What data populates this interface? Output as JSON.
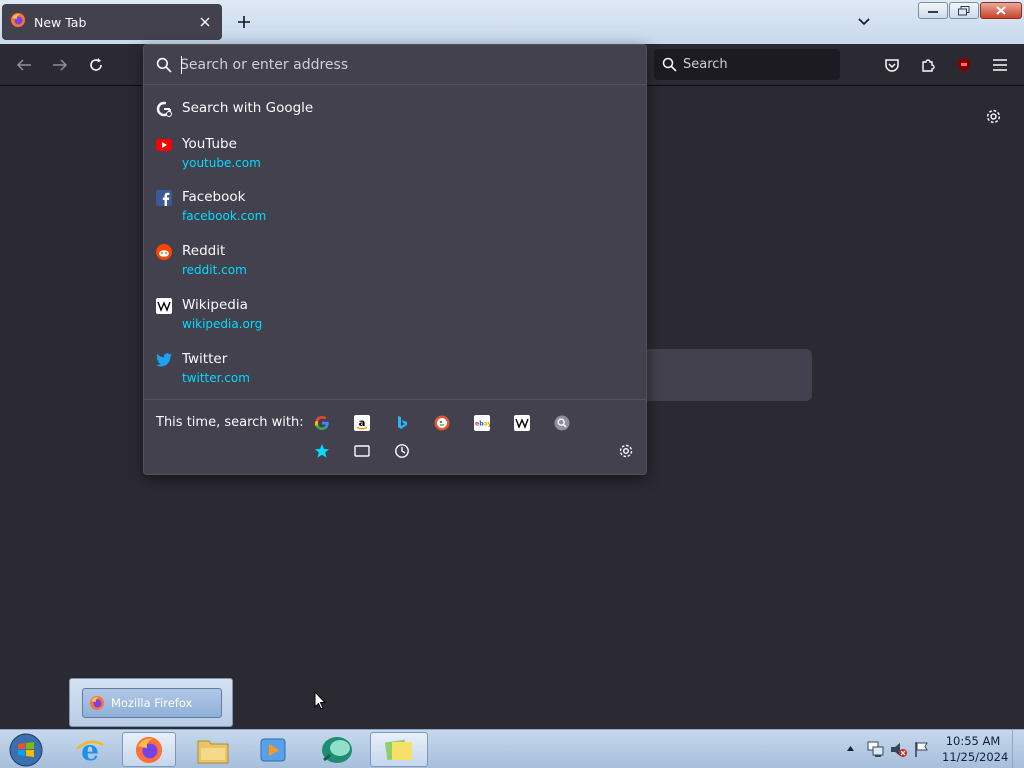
{
  "browser": {
    "tab_title": "New Tab",
    "search_placeholder": "Search",
    "urlbar_placeholder": "Search or enter address"
  },
  "suggestions": {
    "search_with": "Search with Google",
    "items": [
      {
        "title": "YouTube",
        "url": "youtube.com",
        "icon": "youtube-icon"
      },
      {
        "title": "Facebook",
        "url": "facebook.com",
        "icon": "facebook-icon"
      },
      {
        "title": "Reddit",
        "url": "reddit.com",
        "icon": "reddit-icon"
      },
      {
        "title": "Wikipedia",
        "url": "wikipedia.org",
        "icon": "wikipedia-icon"
      },
      {
        "title": "Twitter",
        "url": "twitter.com",
        "icon": "twitter-icon"
      }
    ]
  },
  "one_off": {
    "label": "This time, search with:",
    "engines": [
      "google-icon",
      "amazon-icon",
      "bing-icon",
      "duckduckgo-icon",
      "ebay-icon",
      "wikipedia-icon",
      "search-engine-icon"
    ],
    "modes": [
      "bookmarks-icon",
      "tabs-icon",
      "history-icon"
    ]
  },
  "taskbar": {
    "thumbnail_label": "Mozilla Firefox",
    "time": "10:55 AM",
    "date": "11/25/2024"
  },
  "colors": {
    "panel_bg": "#42414d",
    "toolbar_bg": "#2b2a33",
    "url_link": "#00ddff"
  }
}
